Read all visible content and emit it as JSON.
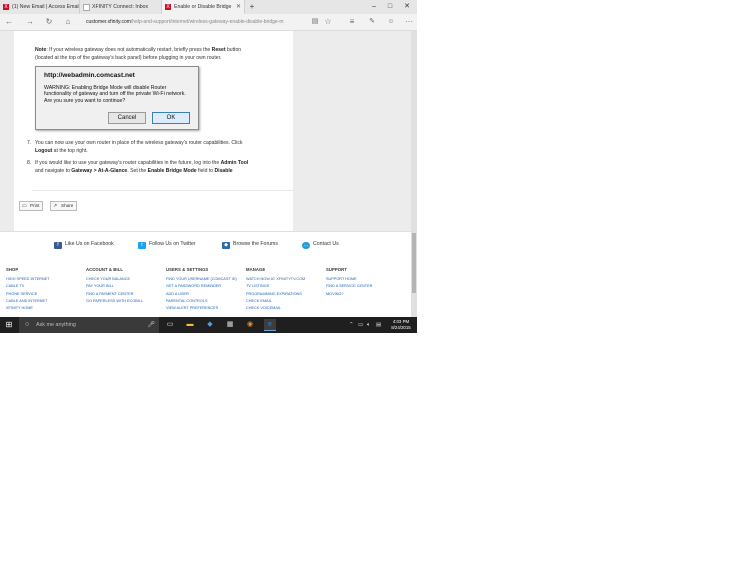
{
  "tabs": [
    {
      "label": "(1) New Email | Access Email",
      "active": false
    },
    {
      "label": "XFINITY Connect: Inbox",
      "active": false
    },
    {
      "label": "Enable or Disable Bridge",
      "active": true
    }
  ],
  "address_bar": {
    "domain": "customer.xfinity.com",
    "path": "/help-and-support/internet/wireless-gateway-enable-disable-bridge-m"
  },
  "note": {
    "label": "Note",
    "text1": ": If your wireless gateway does not automatically restart, briefly press the ",
    "reset": "Reset",
    "text2": " button",
    "line2": "(located at the top of the gateway's back panel) before plugging in your own router."
  },
  "dialog": {
    "title": "http://webadmin.comcast.net",
    "message": "WARNING: Enabling Bridge Mode will disable Router functionality of gateway and turn off the private Wi-Fi network. Are you sure you want to continue?",
    "cancel_label": "Cancel",
    "ok_label": "OK"
  },
  "steps": {
    "step7_num": "7.",
    "step7_a": "You can now use your own router in place of the wireless gateway's router capabilities. Click",
    "step7_logout": "Logout",
    "step7_b": " at the top right.",
    "step8_num": "8.",
    "step8_a": "If you would like to use your gateway's router capabilities in the future, log into the ",
    "step8_admin": "Admin Tool",
    "step8_b": "and navigate to ",
    "step8_path": "Gateway > At-A-Glance",
    "step8_c": ". Set the ",
    "step8_field": "Enable Bridge Mode",
    "step8_d": " field to ",
    "step8_value": "Disable"
  },
  "actions": {
    "print": "Print",
    "share": "Share"
  },
  "social": {
    "facebook": "Like Us on Facebook",
    "twitter": "Follow Us on Twitter",
    "forums": "Browse the Forums",
    "contact": "Contact Us"
  },
  "footer": {
    "columns": [
      {
        "heading": "SHOP",
        "links": [
          "HIGH SPEED INTERNET",
          "CABLE TV",
          "PHONE SERVICE",
          "CABLE AND INTERNET",
          "XFINITY HOME"
        ]
      },
      {
        "heading": "ACCOUNT & BILL",
        "links": [
          "CHECK YOUR BALANCE",
          "PAY YOUR BILL",
          "FIND A PAYMENT CENTER",
          "GO PAPERLESS WITH ECOBILL"
        ]
      },
      {
        "heading": "USERS & SETTINGS",
        "links": [
          "FIND YOUR USERNAME (COMCAST ID)",
          "GET A PASSWORD REMINDER",
          "ADD A USER",
          "PARENTAL CONTROLS",
          "VIEW ALERT PREFERENCES"
        ]
      },
      {
        "heading": "MANAGE",
        "links": [
          "WATCH NOW AT XFINITYTV.COM",
          "TV LISTINGS",
          "PROGRAMMING EXPIRATIONS",
          "CHECK EMAIL",
          "CHECK VOICEMAIL"
        ]
      },
      {
        "heading": "SUPPORT",
        "links": [
          "SUPPORT HOME",
          "FIND A SERVICE CENTER",
          "MOVING?"
        ]
      }
    ]
  },
  "taskbar": {
    "search_placeholder": "Ask me anything",
    "time": "4:03 PM",
    "date": "8/24/2015"
  },
  "colors": {
    "brand_red": "#c8102e",
    "link_blue": "#1a5fb4",
    "taskbar": "#1f1f1f",
    "edge_blue": "#1e6fd6"
  }
}
